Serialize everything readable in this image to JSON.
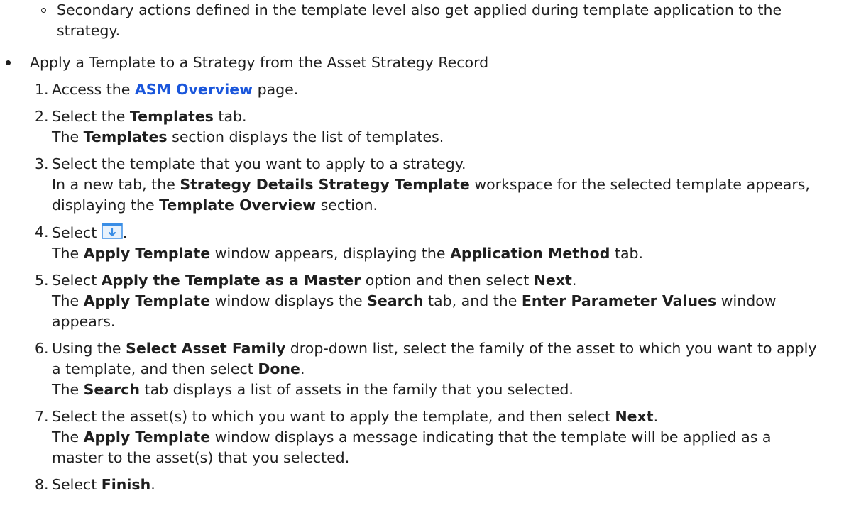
{
  "sub_bullet": {
    "text": "Secondary actions defined in the template level also get applied during template application to the strategy."
  },
  "main_bullet": {
    "text": "Apply a Template to a Strategy from the Asset Strategy Record"
  },
  "steps": [
    {
      "num": "1.",
      "a": "Access the ",
      "link": "ASM Overview",
      "b": " page."
    },
    {
      "num": "2.",
      "a": "Select the ",
      "b1": "Templates",
      "c": " tab.",
      "d": "The ",
      "b2": "Templates",
      "e": " section displays the list of templates."
    },
    {
      "num": "3.",
      "a": "Select the template that you want to apply to a strategy.",
      "b": "In a new tab, the ",
      "b1": "Strategy Details Strategy Template",
      "c": " workspace for the selected template appears, displaying the ",
      "b2": "Template Overview",
      "d": " section."
    },
    {
      "num": "4.",
      "a": "Select ",
      "icon": "apply-template-icon",
      "b": ".",
      "c": "The ",
      "b1": "Apply Template",
      "d": " window appears, displaying the ",
      "b2": "Application Method",
      "e": " tab."
    },
    {
      "num": "5.",
      "a": "Select ",
      "b1": "Apply the Template as a Master",
      "b": " option and then select ",
      "b2": "Next",
      "c": ".",
      "d": "The ",
      "b3": "Apply Template",
      "e": " window displays the ",
      "b4": "Search",
      "f": " tab, and the ",
      "b5": "Enter Parameter Values",
      "g": " window appears."
    },
    {
      "num": "6.",
      "a": "Using the ",
      "b1": "Select Asset Family",
      "b": " drop-down list, select the family of the asset to which you want to apply a template, and then select ",
      "b2": "Done",
      "c": ".",
      "d": "The ",
      "b3": "Search",
      "e": " tab displays a list of assets in the family that you selected."
    },
    {
      "num": "7.",
      "a": "Select the asset(s) to which you want to apply the template, and then select ",
      "b1": "Next",
      "b": ".",
      "c": "The ",
      "b2": "Apply Template",
      "d": " window displays a message indicating that the template will be applied as a master to the asset(s) that you selected."
    },
    {
      "num": "8.",
      "a": "Select ",
      "b1": "Finish",
      "b": "."
    }
  ],
  "colors": {
    "link": "#1a56db",
    "text": "#1f1f1f",
    "icon_blue": "#3a8ee6"
  }
}
